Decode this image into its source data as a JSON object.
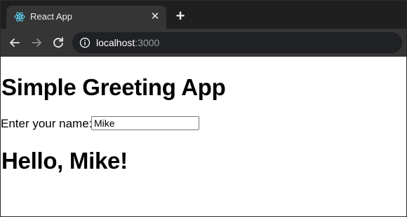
{
  "browser": {
    "tab": {
      "title": "React App",
      "favicon": "react-logo-icon",
      "close_icon": "close-icon"
    },
    "new_tab_icon": "plus-icon",
    "nav": {
      "back_icon": "arrow-left-icon",
      "forward_icon": "arrow-right-icon",
      "reload_icon": "reload-icon"
    },
    "address_bar": {
      "info_icon": "info-icon",
      "host": "localhost",
      "port": ":3000"
    },
    "colors": {
      "tabstrip": "#1f1f1f",
      "toolbar": "#353535",
      "omnibox": "#202124",
      "react_accent": "#61dafb"
    }
  },
  "app": {
    "title": "Simple Greeting App",
    "name_label": "Enter your name:",
    "name_value": "Mike",
    "greeting": "Hello, Mike!"
  }
}
